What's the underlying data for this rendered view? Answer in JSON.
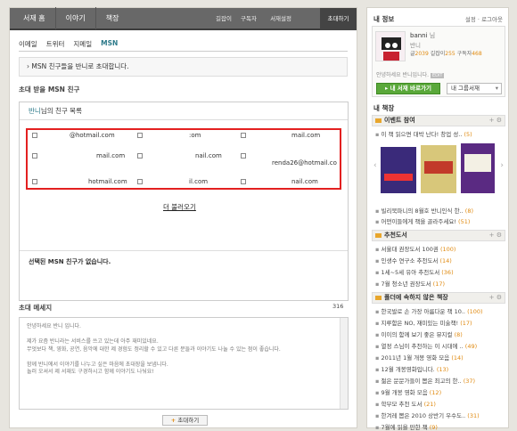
{
  "topnav": {
    "items": [
      "서재 홈",
      "이야기",
      "책장"
    ],
    "sub": [
      "길잡이",
      "구독자",
      "서재설정"
    ],
    "invite": "초대하기"
  },
  "tabs": [
    "이메일",
    "트위터",
    "지메일",
    "MSN"
  ],
  "info": "MSN 친구들을 반니로 초대합니다.",
  "section_title": "초대 받을 MSN 친구",
  "friends_title_name": "반니",
  "friends_title_rest": "님의 친구 목록",
  "emails": [
    "@hotmail.com",
    ":om",
    "mail.com",
    "mail.com",
    "nail.com",
    "renda26@hotmail.co",
    "hotmail.com",
    "il.com",
    "nail.com"
  ],
  "more": "더 불러오기",
  "none_selected": "선택된 MSN 친구가 없습니다.",
  "message": {
    "title": "초대 메세지",
    "count": "316",
    "lines": [
      "안녕하세요 반니 입니다.",
      "",
      "제가 요즘 반니라는 서비스를 쓰고 있는데 아주 재미있네요.",
      "무엇보다 책, 영화, 공연, 음악에 대한 제 경험도 정리할 수 있고 다른 분들과 이야기도 나눌 수 있는 점이 좋습니다.",
      "",
      "함께 반니에서 이야기를 나누고 싶은 마음에 초대장을 보냅니다.",
      "놀러 오셔서 제 서재도 구경하시고 함께 이야기도 나눠요!"
    ]
  },
  "invite_button": "초대하기",
  "sidebar": {
    "myinfo": "내 정보",
    "settings": "설정 · 로그아웃",
    "user": "banni",
    "user_suffix": "님",
    "user_sub": "반니",
    "stats": {
      "posts_label": "글",
      "posts": "2039",
      "guide_label": "길잡이",
      "guide": "255",
      "sub_label": "구독자",
      "sub": "468"
    },
    "greeting": "안녕하세요 반니입니다.",
    "edit": "EDIT",
    "go_btn": "내 서재 바로가기",
    "group_select": "내 그룹서재",
    "shelf_title": "내 책장",
    "groups": [
      {
        "title": "이벤트 참여",
        "items": [
          {
            "t": "이 책 읽으면 대박 난다! 창업 성..",
            "c": "(5)"
          }
        ],
        "tail": [
          {
            "t": "빌리북파니의 8월호 반니인식 한..",
            "c": "(8)"
          },
          {
            "t": "어떤이들에게 책을 골라주세요!",
            "c": "(51)"
          }
        ]
      },
      {
        "title": "추천도서",
        "items": [
          {
            "t": "서울대 권장도서 100권",
            "c": "(100)"
          },
          {
            "t": "인생수 연구소 추천도서",
            "c": "(14)"
          },
          {
            "t": "1세~5세 유아 추천도서",
            "c": "(36)"
          },
          {
            "t": "7월 청소년 권장도서",
            "c": "(17)"
          }
        ]
      },
      {
        "title": "폴더에 속하지 않은 책장",
        "items": [
          {
            "t": "한국발로 손 가장 아름다운 책 10..",
            "c": "(100)"
          },
          {
            "t": "지루함은 NO, 재미있는 미술책!",
            "c": "(17)"
          },
          {
            "t": "이이의 함께 보기 좋은 뮤지컬",
            "c": "(8)"
          },
          {
            "t": "열정 스님이 추천하는 이 시대에 ..",
            "c": "(49)"
          },
          {
            "t": "2011년 1월 개봉 영화 모음",
            "c": "(14)"
          },
          {
            "t": "12월 개봉영화입니다.",
            "c": "(13)"
          },
          {
            "t": "젊은 문문가들이 뽑은 최고의 한..",
            "c": "(37)"
          },
          {
            "t": "9월 개봉 영화 모음",
            "c": "(12)"
          },
          {
            "t": "학부모 추천 도서",
            "c": "(21)"
          },
          {
            "t": "한겨레 뽑은 2010 상반기 우수도..",
            "c": "(31)"
          },
          {
            "t": "7월에 읽을 만한 책",
            "c": "(9)"
          }
        ]
      }
    ]
  }
}
